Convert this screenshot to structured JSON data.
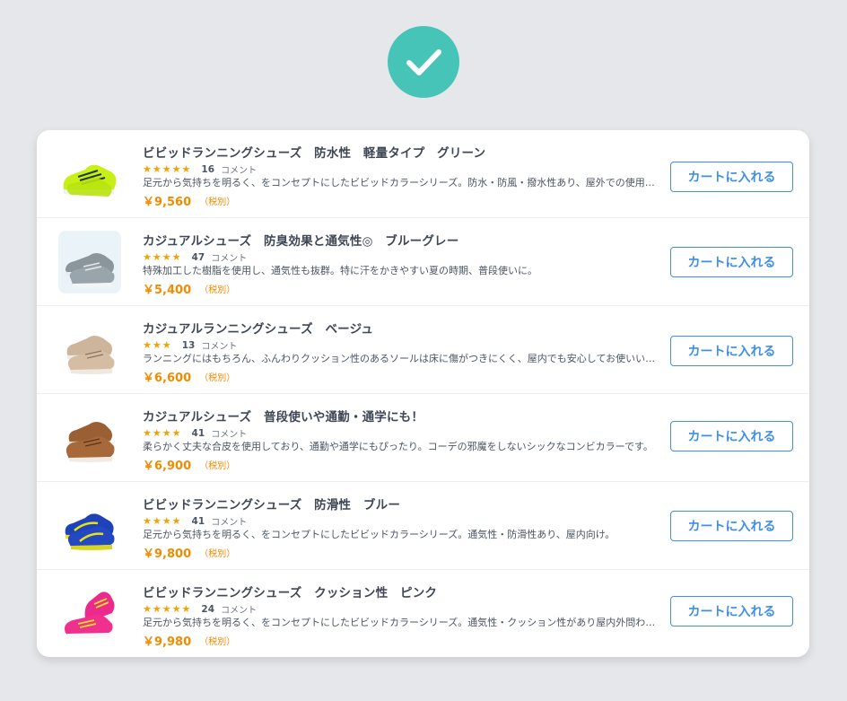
{
  "confirmation": {
    "icon": "check-icon",
    "color": "#45c4b7"
  },
  "products": [
    {
      "title": "ビビッドランニングシューズ　防水性　軽量タイプ　グリーン",
      "stars": "★★★★★",
      "rating": 4.5,
      "review_count": "16",
      "review_suffix": "コメント",
      "description": "足元から気持ちを明るく、をコンセプトにしたビビッドカラーシリーズ。防水・防風・撥水性あり、屋外での使用にも適しています。",
      "price": "￥9,560",
      "tax_note": "（税別）",
      "cart_label": "カートに入れる",
      "image_icon": "green-running-shoe-image"
    },
    {
      "title": "カジュアルシューズ　防臭効果と通気性◎　ブルーグレー",
      "stars": "★★★★",
      "rating": 4,
      "review_count": "47",
      "review_suffix": "コメント",
      "description": "特殊加工した樹脂を使用し、通気性も抜群。特に汗をかきやすい夏の時期、普段使いに。",
      "price": "￥5,400",
      "tax_note": "（税別）",
      "cart_label": "カートに入れる",
      "image_icon": "gray-casual-shoe-image"
    },
    {
      "title": "カジュアルランニングシューズ　ベージュ",
      "stars": "★★★",
      "rating": 3,
      "review_count": "13",
      "review_suffix": "コメント",
      "description": "ランニングにはもちろん、ふんわりクッション性のあるソールは床に傷がつきにくく、屋内でも安心してお使いいただけます。",
      "price": "￥6,600",
      "tax_note": "（税別）",
      "cart_label": "カートに入れる",
      "image_icon": "beige-running-shoe-image"
    },
    {
      "title": "カジュアルシューズ　普段使いや通勤・通学にも！",
      "stars": "★★★★",
      "rating": 3.5,
      "review_count": "41",
      "review_suffix": "コメント",
      "description": "柔らかく丈夫な合皮を使用しており、通勤や通学にもぴったり。コーデの邪魔をしないシックなコンビカラーです。",
      "price": "￥6,900",
      "tax_note": "（税別）",
      "cart_label": "カートに入れる",
      "image_icon": "brown-casual-shoe-image"
    },
    {
      "title": "ビビッドランニングシューズ　防滑性　ブルー",
      "stars": "★★★★",
      "rating": 3.5,
      "review_count": "41",
      "review_suffix": "コメント",
      "description": "足元から気持ちを明るく、をコンセプトにしたビビッドカラーシリーズ。通気性・防滑性あり、屋内向け。",
      "price": "￥9,800",
      "tax_note": "（税別）",
      "cart_label": "カートに入れる",
      "image_icon": "blue-running-shoe-image"
    },
    {
      "title": "ビビッドランニングシューズ　クッション性　ピンク",
      "stars": "★★★★★",
      "rating": 4.5,
      "review_count": "24",
      "review_suffix": "コメント",
      "description": "足元から気持ちを明るく、をコンセプトにしたビビッドカラーシリーズ。通気性・クッション性があり屋内外問わずお使いいただけます。",
      "price": "￥9,980",
      "tax_note": "（税別）",
      "cart_label": "カートに入れる",
      "image_icon": "pink-running-shoe-image"
    }
  ],
  "colors": {
    "accent_blue": "#3f8fe6",
    "price_orange": "#f08c00",
    "star_orange": "#f6a100",
    "check_teal": "#45c4b7"
  }
}
